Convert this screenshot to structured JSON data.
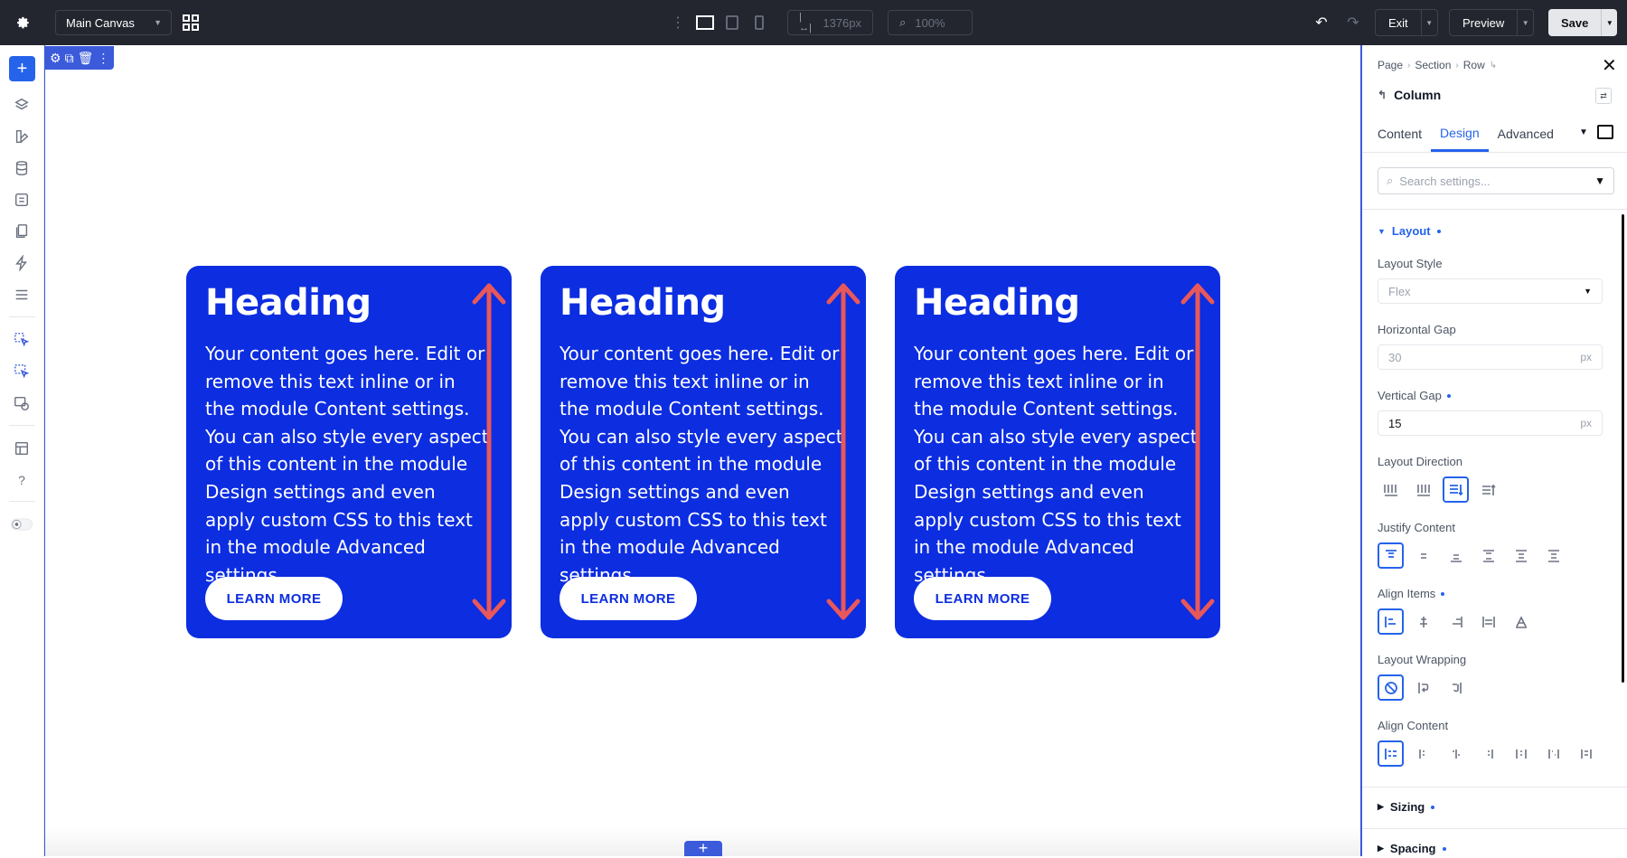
{
  "topbar": {
    "canvas_select": "Main Canvas",
    "width_value": "1376px",
    "zoom_value": "100%",
    "exit_label": "Exit",
    "preview_label": "Preview",
    "save_label": "Save"
  },
  "cards": [
    {
      "heading": "Heading",
      "body": "Your content goes here. Edit or remove this text inline or in the module Content settings. You can also style every aspect of this content in the module Design settings and even apply custom CSS to this text in the module Advanced settings.",
      "button": "LEARN MORE"
    },
    {
      "heading": "Heading",
      "body": "Your content goes here. Edit or remove this text inline or in the module Content settings. You can also style every aspect of this content in the module Design settings and even apply custom CSS to this text in the module Advanced settings.",
      "button": "LEARN MORE"
    },
    {
      "heading": "Heading",
      "body": "Your content goes here. Edit or remove this text inline or in the module Content settings. You can also style every aspect of this content in the module Design settings and even apply custom CSS to this text in the module Advanced settings.",
      "button": "LEARN MORE"
    }
  ],
  "panel": {
    "breadcrumbs": [
      "Page",
      "Section",
      "Row"
    ],
    "title": "Column",
    "tabs": [
      "Content",
      "Design",
      "Advanced"
    ],
    "active_tab": "Design",
    "search_placeholder": "Search settings...",
    "layout_section": "Layout",
    "layout_style_label": "Layout Style",
    "layout_style_value": "Flex",
    "hgap_label": "Horizontal Gap",
    "hgap_value": "30",
    "hgap_unit": "px",
    "vgap_label": "Vertical Gap",
    "vgap_value": "15",
    "vgap_unit": "px",
    "direction_label": "Layout Direction",
    "justify_label": "Justify Content",
    "align_items_label": "Align Items",
    "wrapping_label": "Layout Wrapping",
    "align_content_label": "Align Content",
    "sizing_section": "Sizing",
    "spacing_section": "Spacing"
  },
  "colors": {
    "card_bg": "#0c2de0",
    "accent": "#2563eb",
    "arrow": "#e8585a",
    "topbar_bg": "#23262f"
  }
}
